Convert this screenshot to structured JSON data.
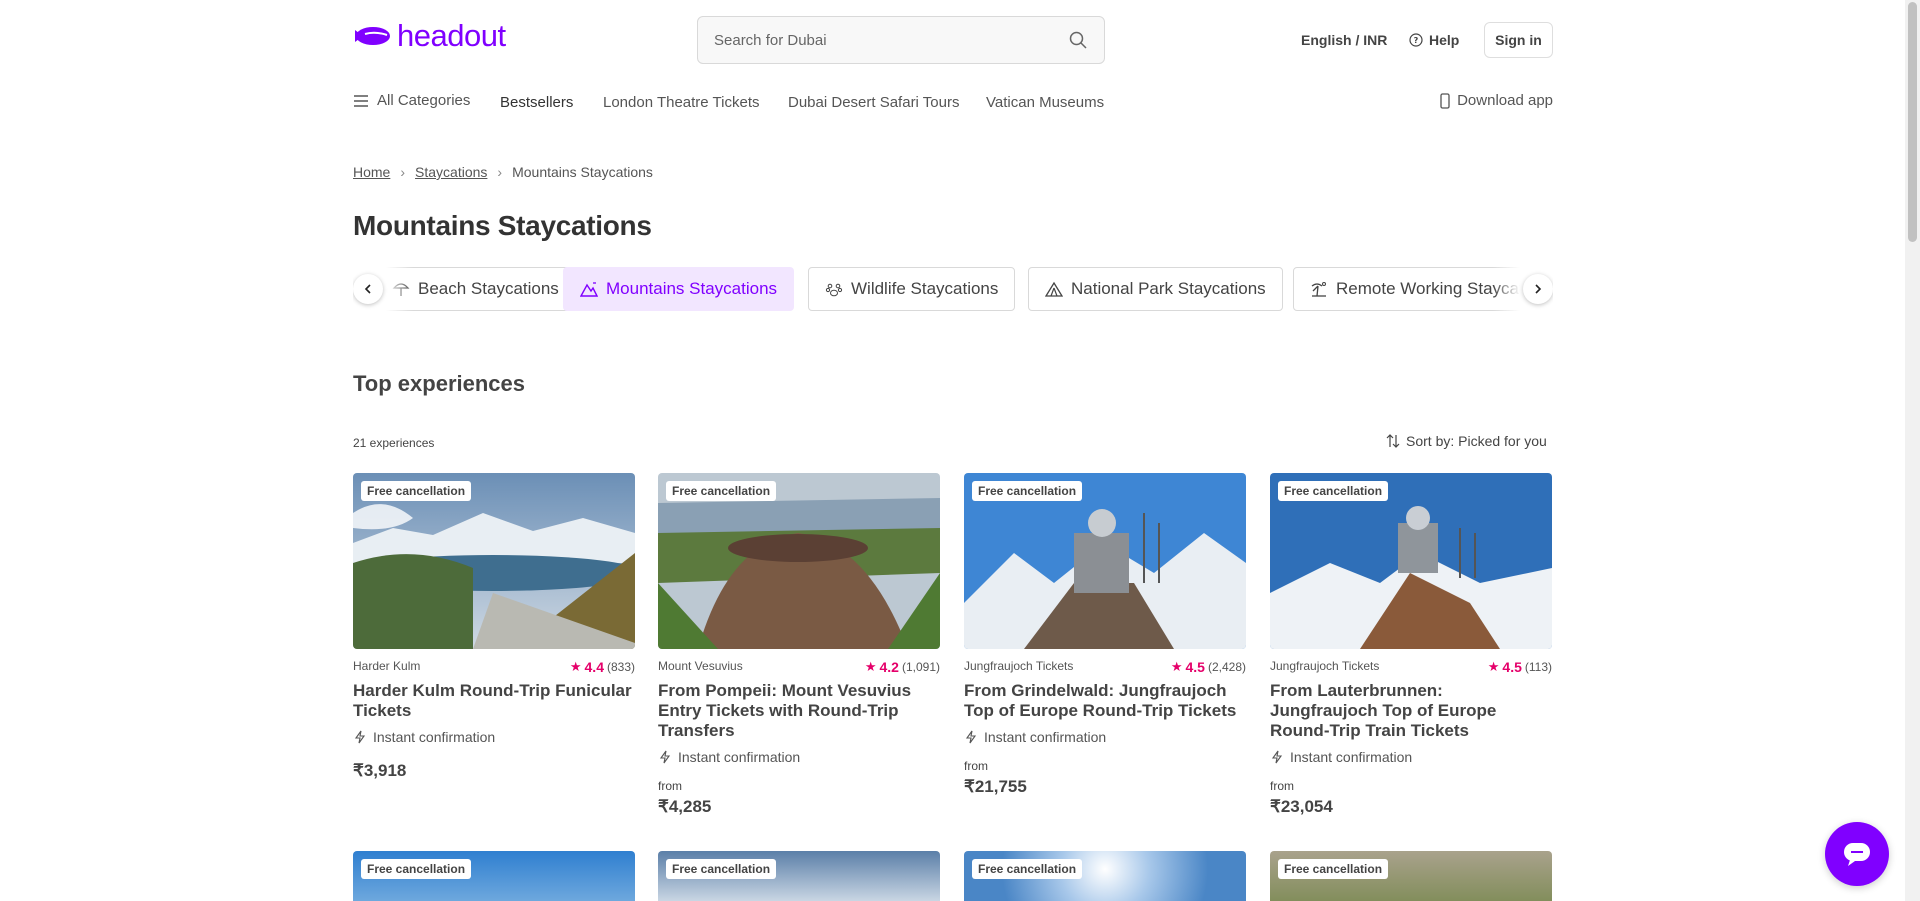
{
  "header": {
    "logo_text": "headout",
    "search_placeholder": "Search for Dubai",
    "language_currency": "English / INR",
    "help_label": "Help",
    "signin_label": "Sign in"
  },
  "nav": {
    "all_categories": "All Categories",
    "items": [
      "Bestsellers",
      "London Theatre Tickets",
      "Dubai Desert Safari Tours",
      "Vatican Museums"
    ],
    "download_app": "Download app"
  },
  "breadcrumb": {
    "home": "Home",
    "staycations": "Staycations",
    "current": "Mountains Staycations"
  },
  "page_title": "Mountains Staycations",
  "category_chips": [
    {
      "label": "Beach Staycations",
      "icon": "beach-umbrella-icon",
      "active": false
    },
    {
      "label": "Mountains Staycations",
      "icon": "mountain-icon",
      "active": true
    },
    {
      "label": "Wildlife Staycations",
      "icon": "paw-icon",
      "active": false
    },
    {
      "label": "National Park Staycations",
      "icon": "tent-icon",
      "active": false
    },
    {
      "label": "Remote Working Staycat",
      "icon": "palm-tree-icon",
      "active": false
    }
  ],
  "section": {
    "title": "Top experiences",
    "count": "21 experiences",
    "sort_label": "Sort by: Picked for you"
  },
  "cards": [
    {
      "badge": "Free cancellation",
      "category": "Harder Kulm",
      "rating": "4.4",
      "reviews": "(833)",
      "title": "Harder Kulm Round-Trip Funicular Tickets",
      "instant": "Instant confirmation",
      "from": "",
      "price": "₹3,918"
    },
    {
      "badge": "Free cancellation",
      "category": "Mount Vesuvius",
      "rating": "4.2",
      "reviews": "(1,091)",
      "title": "From Pompeii: Mount Vesuvius Entry Tickets with Round-Trip Transfers",
      "instant": "Instant confirmation",
      "from": "from",
      "price": "₹4,285"
    },
    {
      "badge": "Free cancellation",
      "category": "Jungfraujoch Tickets",
      "rating": "4.5",
      "reviews": "(2,428)",
      "title": "From Grindelwald: Jungfraujoch Top of Europe Round-Trip Tickets",
      "instant": "Instant confirmation",
      "from": "from",
      "price": "₹21,755"
    },
    {
      "badge": "Free cancellation",
      "category": "Jungfraujoch Tickets",
      "rating": "4.5",
      "reviews": "(113)",
      "title": "From Lauterbrunnen: Jungfraujoch Top of Europe Round-Trip Train Tickets",
      "instant": "Instant confirmation",
      "from": "from",
      "price": "₹23,054"
    }
  ],
  "cards_row2_badges": [
    "Free cancellation",
    "Free cancellation",
    "Free cancellation",
    "Free cancellation"
  ],
  "colors": {
    "brand": "#8000ff",
    "rating": "#e5006a",
    "active_chip_bg": "#f2e6ff"
  }
}
